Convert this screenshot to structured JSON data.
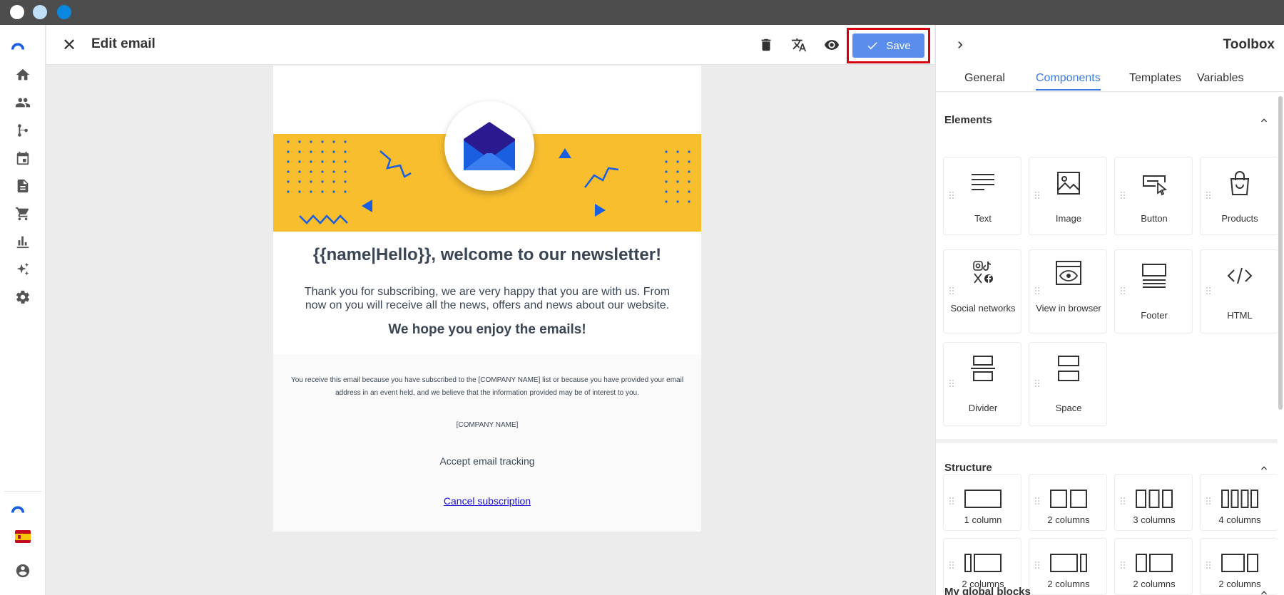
{
  "window": {
    "controls": [
      "close",
      "minimize",
      "maximize"
    ]
  },
  "header": {
    "title": "Edit email",
    "save_label": "Save",
    "icons": [
      "close-icon",
      "trash-icon",
      "translate-icon",
      "eye-icon",
      "check-icon"
    ]
  },
  "nav": {
    "icons": [
      "home-icon",
      "people-icon",
      "flow-icon",
      "calendar-icon",
      "document-icon",
      "cart-icon",
      "chart-icon",
      "sparkle-icon",
      "gear-icon",
      "logo-icon",
      "spain-flag-icon",
      "account-icon"
    ]
  },
  "email": {
    "heading": "{{name|Hello}}, welcome to our newsletter!",
    "body": "Thank you for subscribing, we are very happy that you are with us. From now on you will receive all the news, offers and news about our website.",
    "subheading": "We hope you enjoy the emails!",
    "footer_notice": "You receive this email because you have subscribed to the [COMPANY NAME] list or because you have provided your email address in an event held, and we believe that the information provided may be of interest to you.",
    "company": "[COMPANY NAME]",
    "tracking": "Accept email tracking",
    "cancel": "Cancel subscription",
    "colors": {
      "banner": "#f8be2e",
      "accent": "#1a5fe0",
      "text": "#3b4654"
    }
  },
  "toolbox": {
    "title": "Toolbox",
    "tabs": [
      {
        "label": "General",
        "active": false
      },
      {
        "label": "Components",
        "active": true
      },
      {
        "label": "Templates",
        "active": false
      },
      {
        "label": "Variables",
        "active": false
      }
    ],
    "elements_title": "Elements",
    "elements": [
      {
        "label": "Text",
        "icon": "text-icon"
      },
      {
        "label": "Image",
        "icon": "image-icon"
      },
      {
        "label": "Button",
        "icon": "button-icon"
      },
      {
        "label": "Products",
        "icon": "bag-icon"
      },
      {
        "label": "Social networks",
        "icon": "social-icon"
      },
      {
        "label": "View in browser",
        "icon": "browser-eye-icon"
      },
      {
        "label": "Footer",
        "icon": "footer-icon"
      },
      {
        "label": "HTML",
        "icon": "code-icon"
      },
      {
        "label": "Divider",
        "icon": "divider-icon"
      },
      {
        "label": "Space",
        "icon": "space-icon"
      }
    ],
    "structure_title": "Structure",
    "structures": [
      {
        "label": "1 column",
        "icon": "one-column-icon"
      },
      {
        "label": "2 columns",
        "icon": "two-columns-icon"
      },
      {
        "label": "3 columns",
        "icon": "three-columns-icon"
      },
      {
        "label": "4 columns",
        "icon": "four-columns-icon"
      },
      {
        "label": "2 columns",
        "icon": "narrow-wide-columns-icon"
      },
      {
        "label": "2 columns",
        "icon": "wide-narrow-columns-icon"
      },
      {
        "label": "2 columns",
        "icon": "third-twothirds-columns-icon"
      },
      {
        "label": "2 columns",
        "icon": "twothirds-third-columns-icon"
      }
    ],
    "global_blocks_title": "My global blocks",
    "accent_color": "#3c7ae6"
  }
}
